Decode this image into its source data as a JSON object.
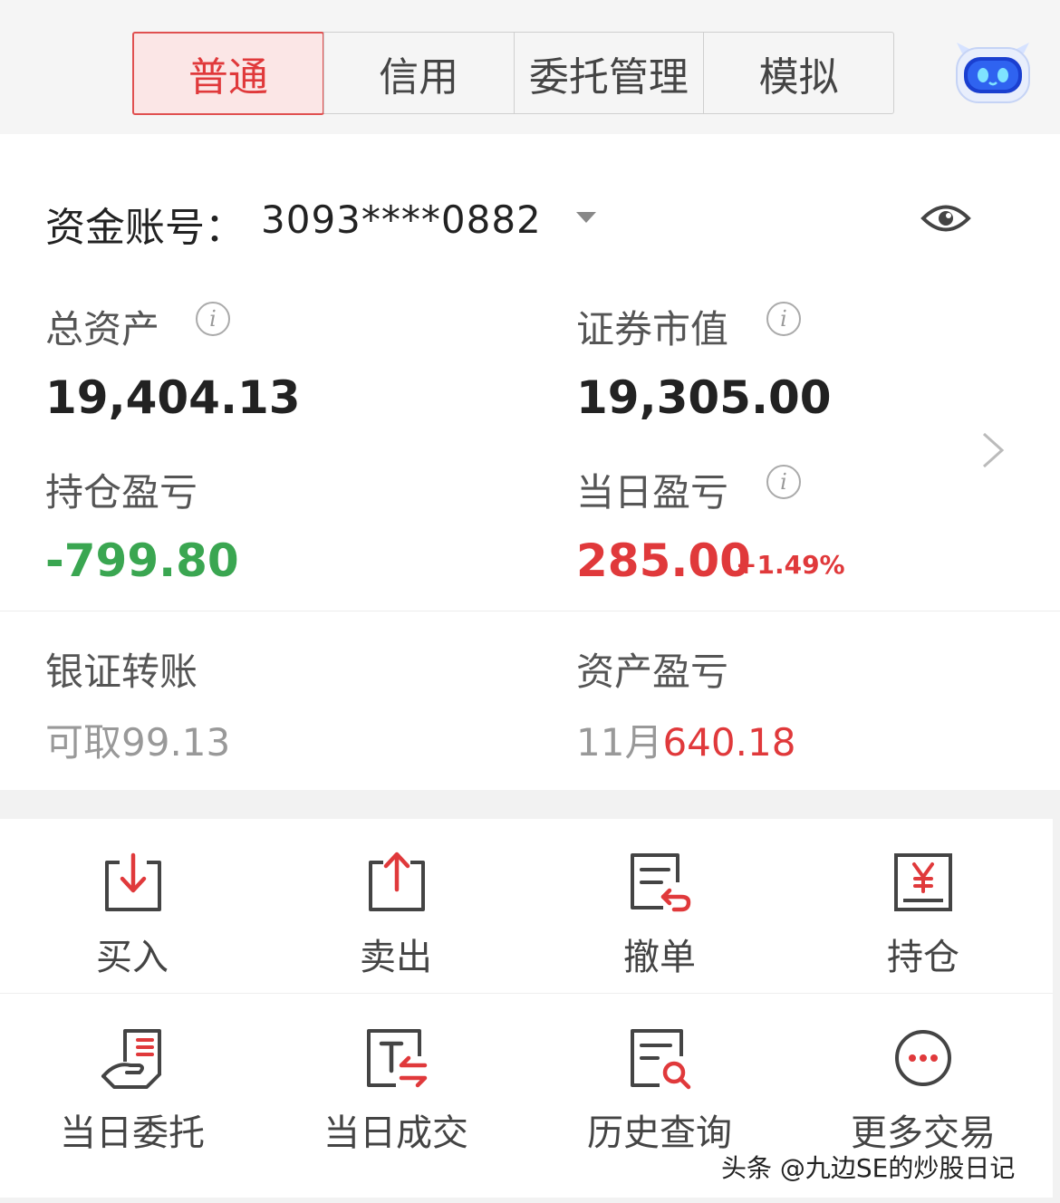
{
  "tabs": [
    "普通",
    "信用",
    "委托管理",
    "模拟"
  ],
  "account": {
    "label": "资金账号：",
    "number": "3093****0882"
  },
  "summary": {
    "total_assets_label": "总资产",
    "total_assets": "19,404.13",
    "market_value_label": "证券市值",
    "market_value": "19,305.00",
    "position_pl_label": "持仓盈亏",
    "position_pl": "-799.80",
    "daily_pl_label": "当日盈亏",
    "daily_pl": "285.00",
    "daily_pl_pct": "+1.49%"
  },
  "transfer": {
    "label": "银证转账",
    "available_prefix": "可取",
    "available": "99.13"
  },
  "asset_pl": {
    "label": "资产盈亏",
    "month": "11月",
    "value": "640.18"
  },
  "actions": [
    {
      "label": "买入",
      "icon": "buy-icon"
    },
    {
      "label": "卖出",
      "icon": "sell-icon"
    },
    {
      "label": "撤单",
      "icon": "cancel-order-icon"
    },
    {
      "label": "持仓",
      "icon": "holdings-icon"
    },
    {
      "label": "当日委托",
      "icon": "daily-orders-icon"
    },
    {
      "label": "当日成交",
      "icon": "daily-trades-icon"
    },
    {
      "label": "历史查询",
      "icon": "history-search-icon"
    },
    {
      "label": "更多交易",
      "icon": "more-icon"
    }
  ],
  "watermark": "头条 @九边SE的炒股日记",
  "colors": {
    "accent_red": "#e0393b",
    "loss_green": "#3aa651"
  }
}
